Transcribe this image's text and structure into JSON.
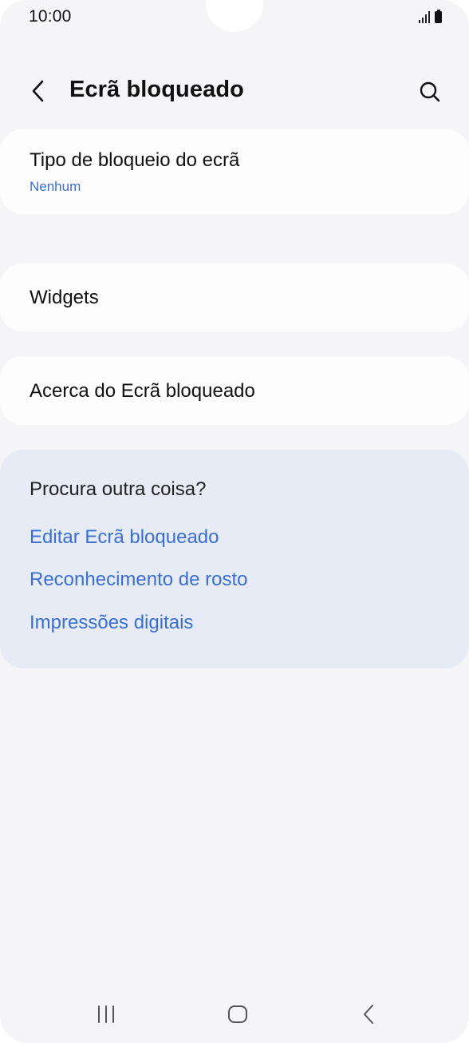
{
  "status_bar": {
    "time": "10:00",
    "icons": [
      "signal-icon",
      "battery-icon"
    ]
  },
  "header": {
    "title": "Ecrã bloqueado",
    "back_icon": "back-arrow-icon",
    "search_icon": "search-icon"
  },
  "settings": {
    "lock_type": {
      "title": "Tipo de bloqueio do ecrã",
      "value": "Nenhum"
    },
    "widgets": {
      "title": "Widgets"
    },
    "about": {
      "title": "Acerca do Ecrã bloqueado"
    }
  },
  "suggestions": {
    "title": "Procura outra coisa?",
    "links": [
      "Editar Ecrã bloqueado",
      "Reconhecimento de rosto",
      "Impressões digitais"
    ]
  },
  "nav_bar": {
    "icons": [
      "recent-apps-icon",
      "home-icon",
      "back-icon"
    ]
  },
  "colors": {
    "background": "#f5f5f7",
    "card": "#fdfdfe",
    "suggestion_bg": "#e6ebf6",
    "accent": "#3a6fd1",
    "text": "#111111"
  }
}
